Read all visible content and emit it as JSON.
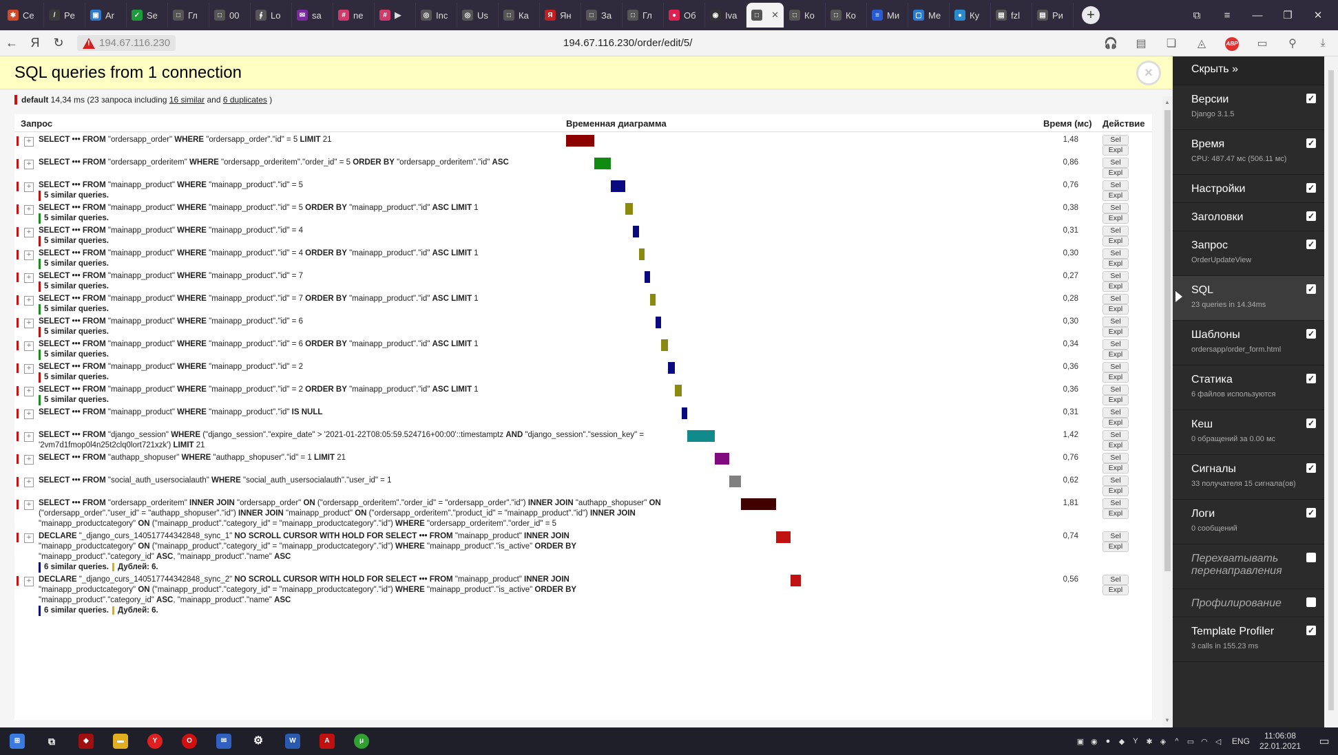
{
  "browser": {
    "tabs": [
      {
        "label": "Ce",
        "color": "#d04a2a",
        "glyph": "✱"
      },
      {
        "label": "Pe",
        "color": "#3a3a3a",
        "glyph": "/"
      },
      {
        "label": "Ar",
        "color": "#2a7ad0",
        "glyph": "▣"
      },
      {
        "label": "Se",
        "color": "#1d9a3a",
        "glyph": "✓"
      },
      {
        "label": "Гл",
        "color": "#555555",
        "glyph": "□"
      },
      {
        "label": "00",
        "color": "#555555",
        "glyph": "□"
      },
      {
        "label": "Lo",
        "color": "#555555",
        "glyph": "∮"
      },
      {
        "label": "sa",
        "color": "#7a2aa0",
        "glyph": "✉"
      },
      {
        "label": "ne",
        "color": "#d03a6a",
        "glyph": "#"
      },
      {
        "label": "▶",
        "color": "#d03a6a",
        "glyph": "#"
      },
      {
        "label": "Inc",
        "color": "#555555",
        "glyph": "◎"
      },
      {
        "label": "Us",
        "color": "#555555",
        "glyph": "◎"
      },
      {
        "label": "Ка",
        "color": "#555555",
        "glyph": "□"
      },
      {
        "label": "Ян",
        "color": "#c02020",
        "glyph": "Я"
      },
      {
        "label": "За",
        "color": "#555555",
        "glyph": "□"
      },
      {
        "label": "Гл",
        "color": "#555555",
        "glyph": "□"
      },
      {
        "label": "Об",
        "color": "#e02050",
        "glyph": "●"
      },
      {
        "label": "Iva",
        "color": "#333333",
        "glyph": "◉"
      },
      {
        "label": "",
        "color": "#555555",
        "glyph": "□",
        "active": true
      },
      {
        "label": "Ко",
        "color": "#555555",
        "glyph": "□"
      },
      {
        "label": "Ко",
        "color": "#555555",
        "glyph": "□"
      },
      {
        "label": "Ми",
        "color": "#2a5ad0",
        "glyph": "≡"
      },
      {
        "label": "Ме",
        "color": "#2a7ad0",
        "glyph": "▢"
      },
      {
        "label": "Ку",
        "color": "#2a8ad0",
        "glyph": "●"
      },
      {
        "label": "fzl",
        "color": "#555555",
        "glyph": "▤"
      },
      {
        "label": "Ри",
        "color": "#555555",
        "glyph": "▤"
      }
    ],
    "domain_chip": "194.67.116.230",
    "url": "194.67.116.230/order/edit/5/"
  },
  "panel": {
    "title": "SQL queries from 1 connection",
    "connection": {
      "alias": "default",
      "summary_pre": " 14,34 ms (23 запроса including ",
      "similar_link": "16 similar",
      "mid": " and ",
      "duplicates_link": "6 duplicates",
      "summary_post": " )"
    },
    "columns": {
      "query": "Запрос",
      "timeline": "Временная диаграмма",
      "time": "Время (мс)",
      "action": "Действие"
    },
    "sel_label": "Sel",
    "expl_label": "Expl",
    "queries": [
      {
        "html": "<b>SELECT ••• FROM</b> \"ordersapp_order\" <b>WHERE</b> \"ordersapp_order\".\"id\" = 5 <b>LIMIT</b> 21",
        "time": "1,48",
        "similar": "",
        "duplicates": "",
        "color": "#8b0000",
        "start": 0.0,
        "width": 0.103
      },
      {
        "html": "<b>SELECT ••• FROM</b> \"ordersapp_orderitem\" <b>WHERE</b> \"ordersapp_orderitem\".\"order_id\" = 5 <b>ORDER BY</b> \"ordersapp_orderitem\".\"id\" <b>ASC</b>",
        "time": "0,86",
        "similar": "",
        "duplicates": "",
        "color": "#108a10",
        "start": 0.103,
        "width": 0.06
      },
      {
        "html": "<b>SELECT ••• FROM</b> \"mainapp_product\" <b>WHERE</b> \"mainapp_product\".\"id\" = 5",
        "time": "0,76",
        "similar": "5 similar queries.",
        "similar_color": "#c01010",
        "duplicates": "",
        "color": "#0a0a80",
        "start": 0.163,
        "width": 0.053
      },
      {
        "html": "<b>SELECT ••• FROM</b> \"mainapp_product\" <b>WHERE</b> \"mainapp_product\".\"id\" = 5 <b>ORDER BY</b> \"mainapp_product\".\"id\" <b>ASC LIMIT</b> 1",
        "time": "0,38",
        "similar": "5 similar queries.",
        "similar_color": "#1d8a1d",
        "duplicates": "",
        "color": "#8a8a10",
        "start": 0.216,
        "width": 0.026
      },
      {
        "html": "<b>SELECT ••• FROM</b> \"mainapp_product\" <b>WHERE</b> \"mainapp_product\".\"id\" = 4",
        "time": "0,31",
        "similar": "5 similar queries.",
        "similar_color": "#c01010",
        "duplicates": "",
        "color": "#0a0a80",
        "start": 0.242,
        "width": 0.022
      },
      {
        "html": "<b>SELECT ••• FROM</b> \"mainapp_product\" <b>WHERE</b> \"mainapp_product\".\"id\" = 4 <b>ORDER BY</b> \"mainapp_product\".\"id\" <b>ASC LIMIT</b> 1",
        "time": "0,30",
        "similar": "5 similar queries.",
        "similar_color": "#1d8a1d",
        "duplicates": "",
        "color": "#8a8a10",
        "start": 0.264,
        "width": 0.021
      },
      {
        "html": "<b>SELECT ••• FROM</b> \"mainapp_product\" <b>WHERE</b> \"mainapp_product\".\"id\" = 7",
        "time": "0,27",
        "similar": "5 similar queries.",
        "similar_color": "#c01010",
        "duplicates": "",
        "color": "#0a0a80",
        "start": 0.285,
        "width": 0.019
      },
      {
        "html": "<b>SELECT ••• FROM</b> \"mainapp_product\" <b>WHERE</b> \"mainapp_product\".\"id\" = 7 <b>ORDER BY</b> \"mainapp_product\".\"id\" <b>ASC LIMIT</b> 1",
        "time": "0,28",
        "similar": "5 similar queries.",
        "similar_color": "#1d8a1d",
        "duplicates": "",
        "color": "#8a8a10",
        "start": 0.304,
        "width": 0.02
      },
      {
        "html": "<b>SELECT ••• FROM</b> \"mainapp_product\" <b>WHERE</b> \"mainapp_product\".\"id\" = 6",
        "time": "0,30",
        "similar": "5 similar queries.",
        "similar_color": "#c01010",
        "duplicates": "",
        "color": "#0a0a80",
        "start": 0.324,
        "width": 0.021
      },
      {
        "html": "<b>SELECT ••• FROM</b> \"mainapp_product\" <b>WHERE</b> \"mainapp_product\".\"id\" = 6 <b>ORDER BY</b> \"mainapp_product\".\"id\" <b>ASC LIMIT</b> 1",
        "time": "0,34",
        "similar": "5 similar queries.",
        "similar_color": "#1d8a1d",
        "duplicates": "",
        "color": "#8a8a10",
        "start": 0.345,
        "width": 0.024
      },
      {
        "html": "<b>SELECT ••• FROM</b> \"mainapp_product\" <b>WHERE</b> \"mainapp_product\".\"id\" = 2",
        "time": "0,36",
        "similar": "5 similar queries.",
        "similar_color": "#c01010",
        "duplicates": "",
        "color": "#0a0a80",
        "start": 0.369,
        "width": 0.025
      },
      {
        "html": "<b>SELECT ••• FROM</b> \"mainapp_product\" <b>WHERE</b> \"mainapp_product\".\"id\" = 2 <b>ORDER BY</b> \"mainapp_product\".\"id\" <b>ASC LIMIT</b> 1",
        "time": "0,36",
        "similar": "5 similar queries.",
        "similar_color": "#1d8a1d",
        "duplicates": "",
        "color": "#8a8a10",
        "start": 0.394,
        "width": 0.025
      },
      {
        "html": "<b>SELECT ••• FROM</b> \"mainapp_product\" <b>WHERE</b> \"mainapp_product\".\"id\" <b>IS NULL</b>",
        "time": "0,31",
        "similar": "",
        "duplicates": "",
        "color": "#0a0a80",
        "start": 0.419,
        "width": 0.022
      },
      {
        "html": "<b>SELECT ••• FROM</b> \"django_session\" <b>WHERE</b> (\"django_session\".\"expire_date\" &gt; '2021-01-22T08:05:59.524716+00:00'::timestamptz <b>AND</b> \"django_session\".\"session_key\" =<br>'2vm7d1fmop0l4n25t2clq0lort721xzk') <b>LIMIT</b> 21",
        "time": "1,42",
        "similar": "",
        "duplicates": "",
        "color": "#108a8a",
        "start": 0.441,
        "width": 0.099
      },
      {
        "html": "<b>SELECT ••• FROM</b> \"authapp_shopuser\" <b>WHERE</b> \"authapp_shopuser\".\"id\" = 1 <b>LIMIT</b> 21",
        "time": "0,76",
        "similar": "",
        "duplicates": "",
        "color": "#800a80",
        "start": 0.54,
        "width": 0.053
      },
      {
        "html": "<b>SELECT ••• FROM</b> \"social_auth_usersocialauth\" <b>WHERE</b> \"social_auth_usersocialauth\".\"user_id\" = 1",
        "time": "0,62",
        "similar": "",
        "duplicates": "",
        "color": "#808080",
        "start": 0.593,
        "width": 0.043
      },
      {
        "html": "<b>SELECT ••• FROM</b> \"ordersapp_orderitem\" <b>INNER JOIN</b> \"ordersapp_order\" <b>ON</b> (\"ordersapp_orderitem\".\"order_id\" = \"ordersapp_order\".\"id\") <b>INNER JOIN</b> \"authapp_shopuser\" <b>ON</b><br>(\"ordersapp_order\".\"user_id\" = \"authapp_shopuser\".\"id\") <b>INNER JOIN</b> \"mainapp_product\" <b>ON</b> (\"ordersapp_orderitem\".\"product_id\" = \"mainapp_product\".\"id\") <b>INNER JOIN</b><br>\"mainapp_productcategory\" <b>ON</b> (\"mainapp_product\".\"category_id\" = \"mainapp_productcategory\".\"id\") <b>WHERE</b> \"ordersapp_orderitem\".\"order_id\" = 5",
        "time": "1,81",
        "similar": "",
        "duplicates": "",
        "color": "#400000",
        "start": 0.636,
        "width": 0.126
      },
      {
        "html": "<b>DECLARE</b> \"_django_curs_140517744342848_sync_1\" <b>NO SCROLL CURSOR WITH HOLD FOR SELECT ••• FROM</b> \"mainapp_product\" <b>INNER JOIN</b><br>\"mainapp_productcategory\" <b>ON</b> (\"mainapp_product\".\"category_id\" = \"mainapp_productcategory\".\"id\") <b>WHERE</b> \"mainapp_product\".\"is_active\" <b>ORDER BY</b><br>\"mainapp_product\".\"category_id\" <b>ASC</b>, \"mainapp_product\".\"name\" <b>ASC</b>",
        "time": "0,74",
        "similar": "6 similar queries.",
        "similar_color": "#0a0a80",
        "duplicates": "Дублей: 6.",
        "color": "#c01010",
        "start": 0.762,
        "width": 0.052
      },
      {
        "html": "<b>DECLARE</b> \"_django_curs_140517744342848_sync_2\" <b>NO SCROLL CURSOR WITH HOLD FOR SELECT ••• FROM</b> \"mainapp_product\" <b>INNER JOIN</b><br>\"mainapp_productcategory\" <b>ON</b> (\"mainapp_product\".\"category_id\" = \"mainapp_productcategory\".\"id\") <b>WHERE</b> \"mainapp_product\".\"is_active\" <b>ORDER BY</b><br>\"mainapp_product\".\"category_id\" <b>ASC</b>, \"mainapp_product\".\"name\" <b>ASC</b>",
        "time": "0,56",
        "similar": "6 similar queries.",
        "similar_color": "#0a0a80",
        "duplicates": "Дублей: 6.",
        "color": "#c01010",
        "start": 0.814,
        "width": 0.039
      }
    ]
  },
  "toolbar": {
    "hide_label": "Скрыть »",
    "panels": [
      {
        "label": "Версии",
        "sub": "Django 3.1.5",
        "checked": true
      },
      {
        "label": "Время",
        "sub": "CPU: 487.47 мс (506.11 мс)",
        "checked": true
      },
      {
        "label": "Настройки",
        "sub": "",
        "checked": true
      },
      {
        "label": "Заголовки",
        "sub": "",
        "checked": true
      },
      {
        "label": "Запрос",
        "sub": "OrderUpdateView",
        "checked": true
      },
      {
        "label": "SQL",
        "sub": "23 queries in 14.34ms",
        "checked": true,
        "active": true
      },
      {
        "label": "Шаблоны",
        "sub": "ordersapp/order_form.html",
        "checked": true
      },
      {
        "label": "Статика",
        "sub": "6 файлов используются",
        "checked": true
      },
      {
        "label": "Кеш",
        "sub": "0 обращений за 0.00 мс",
        "checked": true
      },
      {
        "label": "Сигналы",
        "sub": "33 получателя 15 сигнала(ов)",
        "checked": true
      },
      {
        "label": "Логи",
        "sub": "0 сообщений",
        "checked": true
      },
      {
        "label": "Перехватывать перенаправления",
        "sub": "",
        "checked": false,
        "italic": true
      },
      {
        "label": "Профилирование",
        "sub": "",
        "checked": false,
        "italic": true
      },
      {
        "label": "Template Profiler",
        "sub": "3 calls in 155.23 ms",
        "checked": true
      }
    ]
  },
  "taskbar": {
    "lang": "ENG",
    "time": "11:06:08",
    "date": "22.01.2021"
  }
}
